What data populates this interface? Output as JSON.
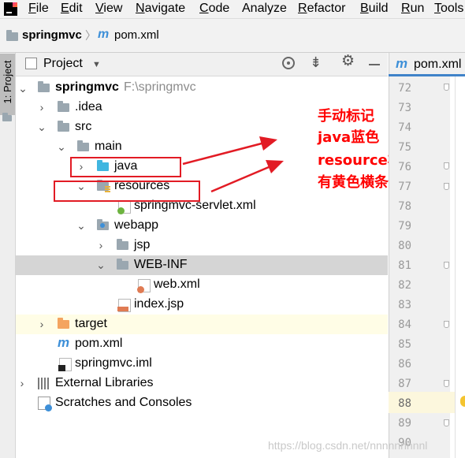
{
  "menubar": {
    "items": [
      {
        "mnemonic": "F",
        "rest": "ile"
      },
      {
        "mnemonic": "E",
        "rest": "dit"
      },
      {
        "mnemonic": "V",
        "rest": "iew"
      },
      {
        "mnemonic": "N",
        "rest": "avigate"
      },
      {
        "mnemonic": "C",
        "rest": "ode"
      },
      {
        "mnemonic": "",
        "rest": "Analyze"
      },
      {
        "mnemonic": "R",
        "rest": "efactor"
      },
      {
        "mnemonic": "B",
        "rest": "uild"
      },
      {
        "mnemonic": "R",
        "rest": "un"
      },
      {
        "mnemonic": "T",
        "rest": "ools"
      }
    ]
  },
  "breadcrumb": {
    "project": "springmvc",
    "separator": "〉",
    "file": "pom.xml"
  },
  "tool_stripe": {
    "label": "1: Project"
  },
  "project_panel": {
    "title": "Project",
    "dropdown_icon": "triangle-down-icon"
  },
  "tree": {
    "root_name": "springmvc",
    "root_path": "F:\\springmvc",
    "idea": ".idea",
    "src": "src",
    "main": "main",
    "java": "java",
    "resources": "resources",
    "servlet_xml": "springmvc-servlet.xml",
    "webapp": "webapp",
    "jsp": "jsp",
    "webinf": "WEB-INF",
    "web_xml": "web.xml",
    "index_jsp": "index.jsp",
    "target": "target",
    "pom": "pom.xml",
    "iml": "springmvc.iml",
    "external_libraries": "External Libraries",
    "scratches": "Scratches and Consoles"
  },
  "annotation": {
    "lines": [
      "手动标记",
      "java蓝色",
      "resource右下角",
      "有黄色横条"
    ],
    "color": "#ff0000"
  },
  "editor": {
    "tab_label": "pom.xml",
    "line_numbers": [
      "72",
      "73",
      "74",
      "75",
      "76",
      "77",
      "78",
      "79",
      "80",
      "81",
      "82",
      "83",
      "84",
      "85",
      "86",
      "87",
      "88",
      "89",
      "90"
    ],
    "current_line": "88"
  },
  "watermark": "https://blog.csdn.net/nnnnnnnnnl"
}
